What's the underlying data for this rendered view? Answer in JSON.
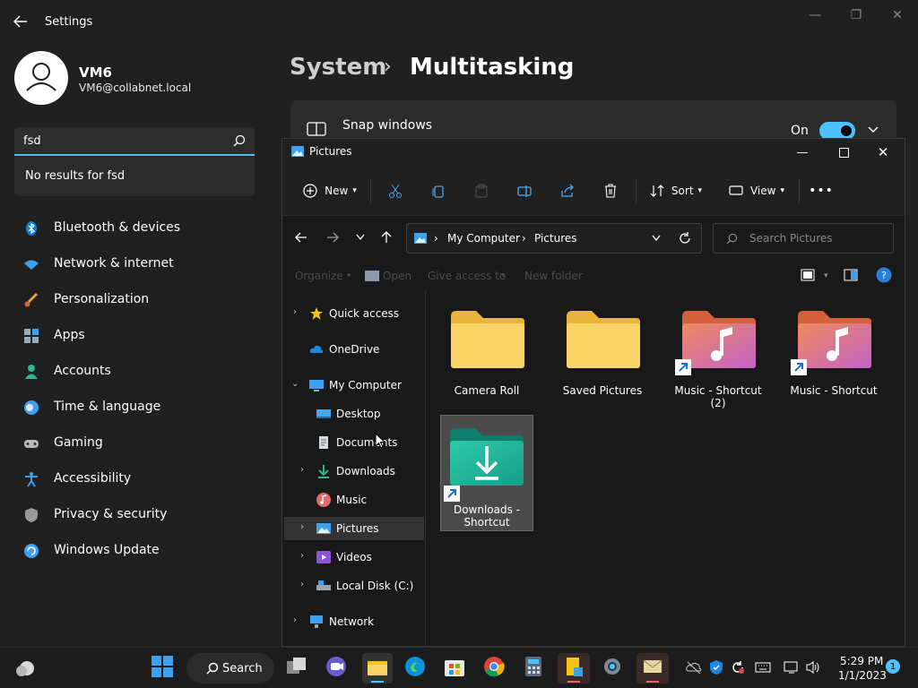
{
  "settings": {
    "title": "Settings",
    "user": {
      "name": "VM6",
      "email": "VM6@collabnet.local"
    },
    "search": {
      "value": "fsd",
      "no_results": "No results for fsd"
    },
    "nav": [
      {
        "label": "Bluetooth & devices",
        "icon": "bluetooth-icon"
      },
      {
        "label": "Network & internet",
        "icon": "wifi-icon"
      },
      {
        "label": "Personalization",
        "icon": "brush-icon"
      },
      {
        "label": "Apps",
        "icon": "apps-icon"
      },
      {
        "label": "Accounts",
        "icon": "person-icon"
      },
      {
        "label": "Time & language",
        "icon": "clock-globe-icon"
      },
      {
        "label": "Gaming",
        "icon": "gamepad-icon"
      },
      {
        "label": "Accessibility",
        "icon": "accessibility-icon"
      },
      {
        "label": "Privacy & security",
        "icon": "shield-icon"
      },
      {
        "label": "Windows Update",
        "icon": "update-icon"
      }
    ],
    "breadcrumb": {
      "parent": "System",
      "separator": "›",
      "current": "Multitasking"
    },
    "snap": {
      "label": "Snap windows",
      "state": "On"
    }
  },
  "explorer": {
    "title": "Pictures",
    "toolbar": {
      "new": "New",
      "sort": "Sort",
      "view": "View"
    },
    "address": {
      "root": "My Computer",
      "current": "Pictures"
    },
    "search_placeholder": "Search Pictures",
    "command_bar": {
      "organize": "Organize",
      "open": "Open",
      "give_access": "Give access to",
      "new_folder": "New folder"
    },
    "tree": {
      "quick_access": "Quick access",
      "onedrive": "OneDrive",
      "my_computer": "My Computer",
      "desktop": "Desktop",
      "documents": "Documents",
      "downloads": "Downloads",
      "music": "Music",
      "pictures": "Pictures",
      "videos": "Videos",
      "local_disk": "Local Disk (C:)",
      "network": "Network"
    },
    "items": [
      {
        "label": "Camera Roll",
        "type": "folder"
      },
      {
        "label": "Saved Pictures",
        "type": "folder"
      },
      {
        "label": "Music - Shortcut (2)",
        "type": "music-shortcut"
      },
      {
        "label": "Music - Shortcut",
        "type": "music-shortcut"
      },
      {
        "label": "Downloads - Shortcut",
        "type": "downloads-shortcut"
      }
    ]
  },
  "taskbar": {
    "search_label": "Search",
    "time": "5:29 PM",
    "date": "1/1/2023",
    "notification_count": "1"
  },
  "colors": {
    "accent": "#4cc2ff",
    "folder": "#f6c94a",
    "selected_tile": "#4a4a4a"
  }
}
